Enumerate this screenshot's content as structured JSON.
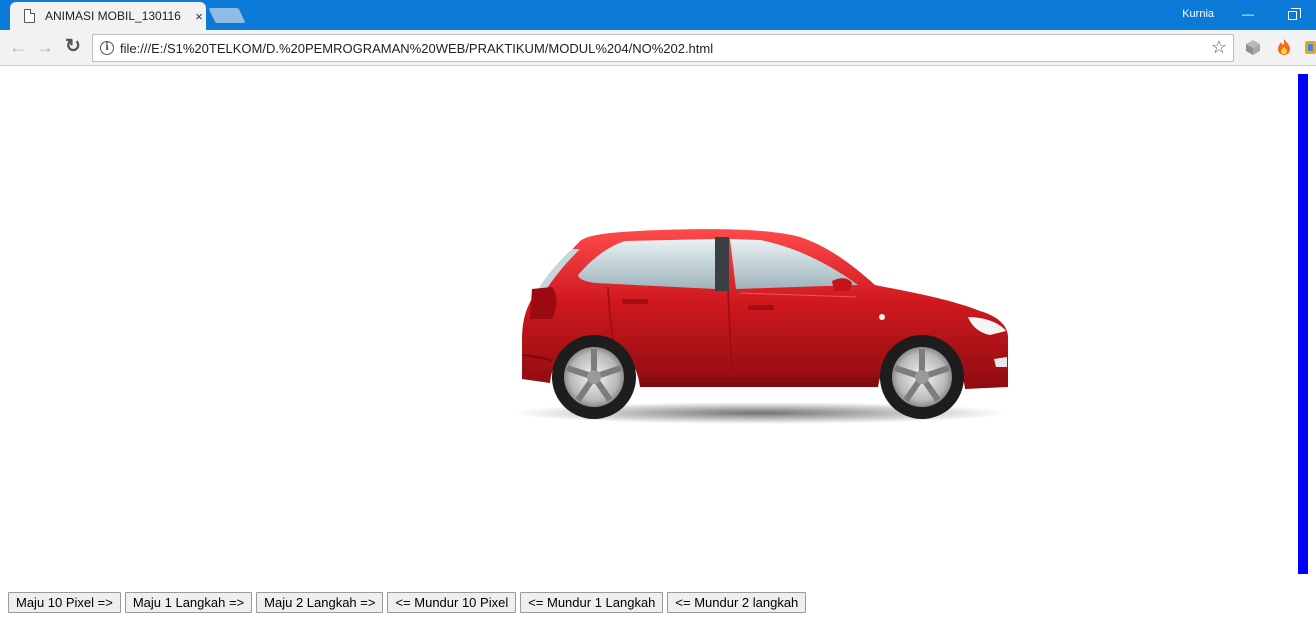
{
  "browser": {
    "tab_title": "ANIMASI MOBIL_130116",
    "tab_close": "×",
    "user_name": "Kurnia",
    "minimize_glyph": "—",
    "url": "file:///E:/S1%20TELKOM/D.%20PEMROGRAMAN%20WEB/PRAKTIKUM/MODUL%204/NO%202.html",
    "info_glyph": "i",
    "star_glyph": "☆",
    "back_glyph": "←",
    "forward_glyph": "→",
    "reload_glyph": "↻"
  },
  "page": {
    "car_color": "#d0191f",
    "marker_color": "#0000ff",
    "buttons": [
      "Maju 10 Pixel =>",
      "Maju 1 Langkah =>",
      "Maju 2 Langkah =>",
      "<= Mundur 10 Pixel",
      "<= Mundur 1 Langkah",
      "<= Mundur 2 langkah"
    ]
  }
}
